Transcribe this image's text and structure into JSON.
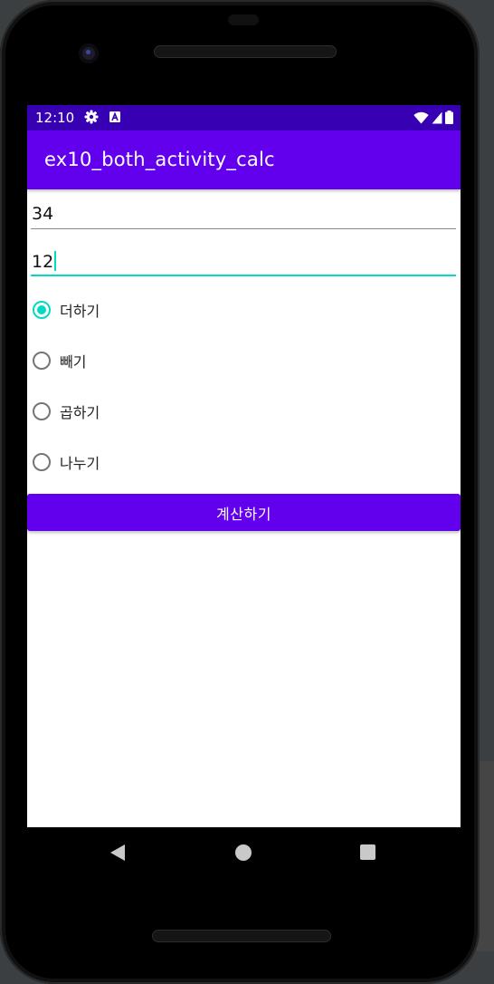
{
  "status_bar": {
    "time": "12:10",
    "icons": [
      "gear-icon",
      "a-notification-icon",
      "wifi-icon",
      "signal-icon",
      "battery-icon"
    ]
  },
  "app_bar": {
    "title": "ex10_both_activity_calc"
  },
  "inputs": {
    "first_number": "34",
    "second_number": "12"
  },
  "operations": [
    {
      "label": "더하기",
      "checked": true
    },
    {
      "label": "빼기",
      "checked": false
    },
    {
      "label": "곱하기",
      "checked": false
    },
    {
      "label": "나누기",
      "checked": false
    }
  ],
  "calculate_button": {
    "label": "계산하기"
  },
  "navigation": {
    "icons": [
      "back-icon",
      "home-icon",
      "recents-icon"
    ]
  },
  "colors": {
    "primary": "#6200ee",
    "primary_dark": "#3700b3",
    "accent": "#03dac5"
  }
}
